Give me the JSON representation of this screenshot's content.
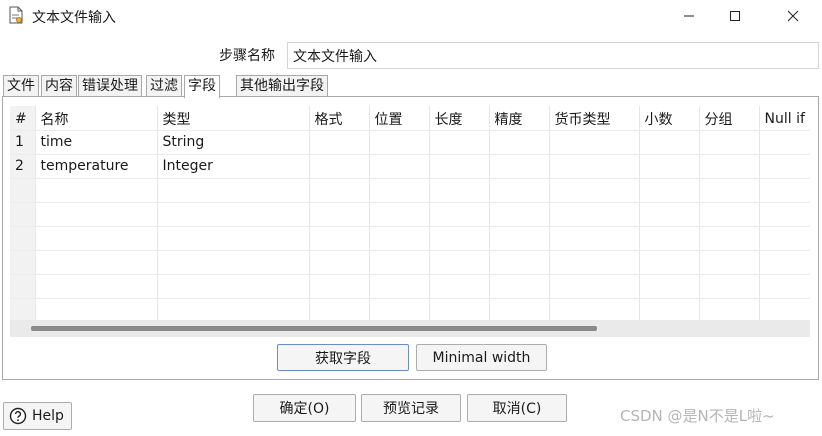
{
  "window": {
    "title": "文本文件输入"
  },
  "step": {
    "label": "步骤名称",
    "value": "文本文件输入"
  },
  "tabs": [
    {
      "label": "文件"
    },
    {
      "label": "内容"
    },
    {
      "label": "错误处理"
    },
    {
      "label": "过滤"
    },
    {
      "label": "字段",
      "active": true
    },
    {
      "label": "其他输出字段"
    }
  ],
  "table": {
    "columns": [
      "#",
      "名称",
      "类型",
      "格式",
      "位置",
      "长度",
      "精度",
      "货币类型",
      "小数",
      "分组",
      "Null if"
    ],
    "rows": [
      [
        "1",
        "time",
        "String",
        "",
        "",
        "",
        "",
        "",
        "",
        "",
        ""
      ],
      [
        "2",
        "temperature",
        "Integer",
        "",
        "",
        "",
        "",
        "",
        "",
        "",
        ""
      ]
    ]
  },
  "buttons": {
    "get_fields": "获取字段",
    "min_width": "Minimal width",
    "ok": "确定(O)",
    "preview": "预览记录",
    "cancel": "取消(C)",
    "help": "Help"
  },
  "watermark": "CSDN @是N不是L啦~",
  "icons": [
    "file-icon",
    "minimize-icon",
    "maximize-icon",
    "close-icon",
    "help-icon"
  ]
}
